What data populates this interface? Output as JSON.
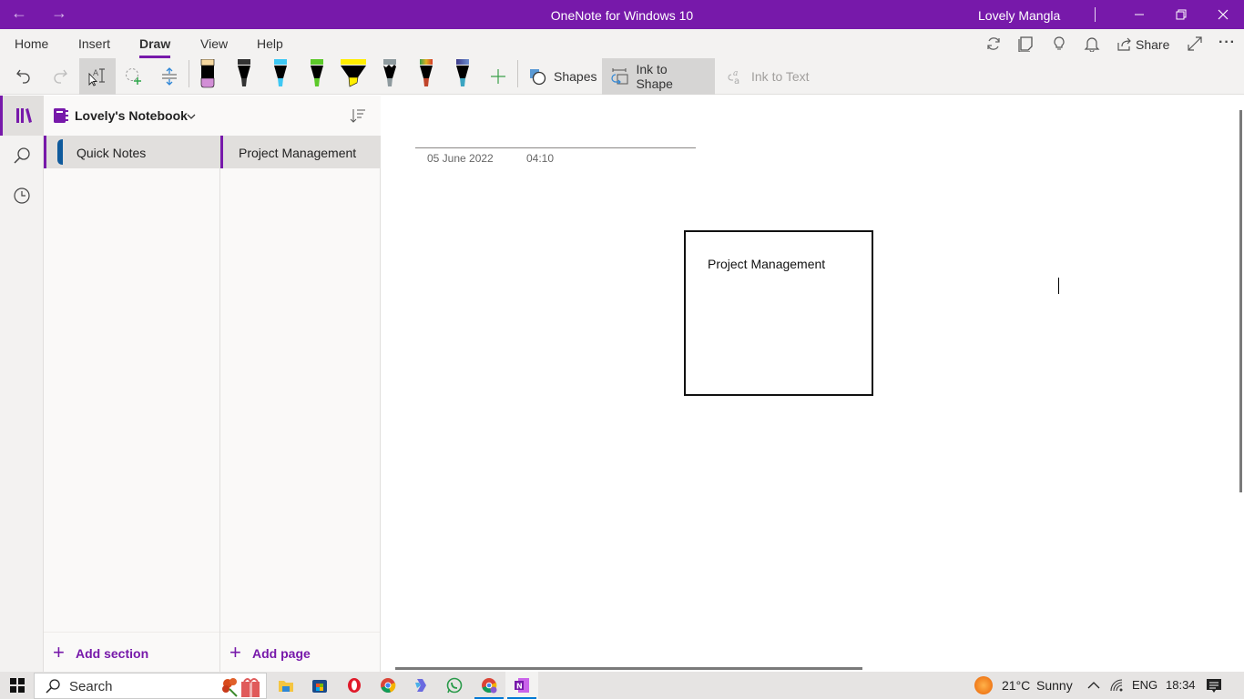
{
  "window": {
    "title": "OneNote for Windows 10",
    "user": "Lovely Mangla",
    "back_icon": "←",
    "forward_icon": "→",
    "minimize_icon": "—",
    "maximize_icon": "❐",
    "close_icon": "✕"
  },
  "ribbon": {
    "tabs": [
      {
        "label": "Home"
      },
      {
        "label": "Insert"
      },
      {
        "label": "Draw",
        "active": true
      },
      {
        "label": "View"
      },
      {
        "label": "Help"
      }
    ],
    "right_icons": {
      "sync": "⟳",
      "sticky_notes": "▢",
      "ideas": "💡",
      "notifications": "🔔",
      "share_label": "Share",
      "expand": "⤢",
      "more": "···"
    },
    "tools": {
      "undo": "↶",
      "redo": "↷",
      "lasso_type": "AI",
      "lasso_select": "◌",
      "add_space": "⇕",
      "add_pen": "+",
      "shapes_label": "Shapes",
      "ink_to_shape_label": "Ink to Shape",
      "ink_to_text_label": "Ink to Text"
    },
    "pens": [
      {
        "name": "eraser",
        "top": "#f5d79e",
        "tip": "#d28fd6"
      },
      {
        "name": "black-pen",
        "top": "#333333",
        "tip": "#333333"
      },
      {
        "name": "blue-pen",
        "top": "#3fc8f4",
        "tip": "#3fc8f4"
      },
      {
        "name": "green-pen",
        "top": "#5cc92a",
        "tip": "#5cc92a"
      },
      {
        "name": "yellow-highlighter",
        "top": "#ffee00",
        "tip": "#ffee00"
      },
      {
        "name": "silver-pen",
        "top": "#8e9a9e",
        "tip": "#8e9a9e"
      },
      {
        "name": "rainbow-pen",
        "top": "#d67a2a",
        "tip": "#c0442a"
      },
      {
        "name": "galaxy-pen",
        "top": "#4b4aa0",
        "tip": "#3ba5c2"
      }
    ]
  },
  "nav": {
    "rail": {
      "notebooks": "notebooks",
      "search": "search",
      "recent": "recent"
    },
    "notebook_name": "Lovely's Notebook",
    "sections": [
      {
        "label": "Quick Notes",
        "color": "#0f5a9c"
      }
    ],
    "pages": [
      {
        "label": "Project Management"
      }
    ],
    "add_section_label": "Add section",
    "add_page_label": "Add page"
  },
  "page": {
    "date": "05 June 2022",
    "time": "04:10",
    "shape_text": "Project Management"
  },
  "taskbar": {
    "search_label": "Search",
    "weather_temp": "21°C",
    "weather_desc": "Sunny",
    "language": "ENG",
    "clock": "18:34",
    "apps": [
      {
        "name": "file-explorer"
      },
      {
        "name": "microsoft-store"
      },
      {
        "name": "opera"
      },
      {
        "name": "chrome"
      },
      {
        "name": "copilot"
      },
      {
        "name": "whatsapp"
      },
      {
        "name": "chrome-profile"
      },
      {
        "name": "onenote"
      }
    ]
  }
}
